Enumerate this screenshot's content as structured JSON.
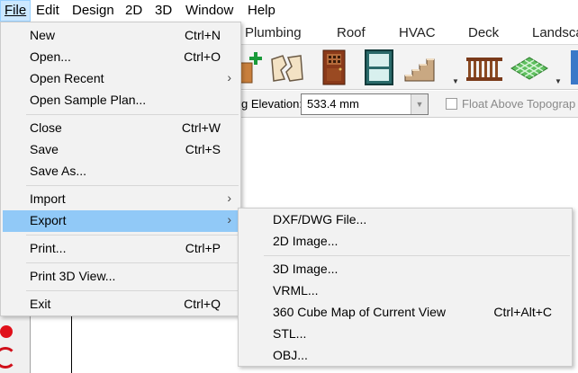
{
  "menubar": {
    "items": [
      "File",
      "Edit",
      "Design",
      "2D",
      "3D",
      "Window",
      "Help"
    ]
  },
  "tabs": [
    "Plumbing",
    "Roof",
    "HVAC",
    "Deck",
    "Landsca"
  ],
  "toolbar": {
    "icons": [
      "fence-plus-icon",
      "broken-wall-icon",
      "door-icon",
      "window-icon",
      "stairs-icon",
      "railing-icon",
      "terrain-icon"
    ]
  },
  "elevation": {
    "label": "g Elevation:",
    "value": "533.4 mm",
    "float_label": "Float Above Topograp"
  },
  "file_menu": {
    "items": [
      {
        "label": "New",
        "shortcut": "Ctrl+N"
      },
      {
        "label": "Open...",
        "shortcut": "Ctrl+O"
      },
      {
        "label": "Open Recent",
        "shortcut": ""
      },
      {
        "label": "Open Sample Plan...",
        "shortcut": ""
      },
      {
        "label": "Close",
        "shortcut": "Ctrl+W"
      },
      {
        "label": "Save",
        "shortcut": "Ctrl+S"
      },
      {
        "label": "Save As...",
        "shortcut": ""
      },
      {
        "label": "Import",
        "shortcut": ""
      },
      {
        "label": "Export",
        "shortcut": ""
      },
      {
        "label": "Print...",
        "shortcut": "Ctrl+P"
      },
      {
        "label": "Print 3D View...",
        "shortcut": ""
      },
      {
        "label": "Exit",
        "shortcut": "Ctrl+Q"
      }
    ],
    "submenu_arrow": "›"
  },
  "export_menu": {
    "items": [
      {
        "label": "DXF/DWG File...",
        "shortcut": ""
      },
      {
        "label": "2D Image...",
        "shortcut": ""
      },
      {
        "label": "3D Image...",
        "shortcut": ""
      },
      {
        "label": "VRML...",
        "shortcut": ""
      },
      {
        "label": "360 Cube Map of Current View",
        "shortcut": "Ctrl+Alt+C"
      },
      {
        "label": "STL...",
        "shortcut": ""
      },
      {
        "label": "OBJ...",
        "shortcut": ""
      }
    ]
  },
  "colors": {
    "menu_bg": "#f2f2f2",
    "highlight": "#91c9f7",
    "menubar_active": "#cce8ff"
  }
}
